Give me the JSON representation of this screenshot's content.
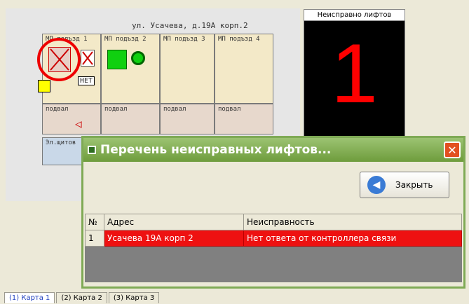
{
  "scheme": {
    "street": "ул. Усачева, д.19А корп.2",
    "entries": [
      "МП подъзд 1",
      "МП подъзд 2",
      "МП подъзд 3",
      "МП подъзд 4"
    ],
    "basements": [
      "подвал",
      "подвал",
      "подвал",
      "подвал"
    ],
    "shield_label": "Эл.щитов",
    "no_label": "НЕТ"
  },
  "panel": {
    "header": "Неисправно лифтов",
    "count": "1"
  },
  "dialog": {
    "title": "Перечень неисправных лифтов...",
    "close_label": "Закрыть",
    "columns": [
      "№",
      "Адрес",
      "Неисправность"
    ],
    "rows": [
      {
        "nr": "1",
        "address": "Усачева 19А корп 2",
        "fault": "Нет ответа от контроллера связи"
      }
    ]
  },
  "tabs": [
    "(1) Карта 1",
    "(2) Карта 2",
    "(3) Карта 3"
  ],
  "colors": {
    "alarm": "#ff0000",
    "titlebar": "#7faa55"
  }
}
